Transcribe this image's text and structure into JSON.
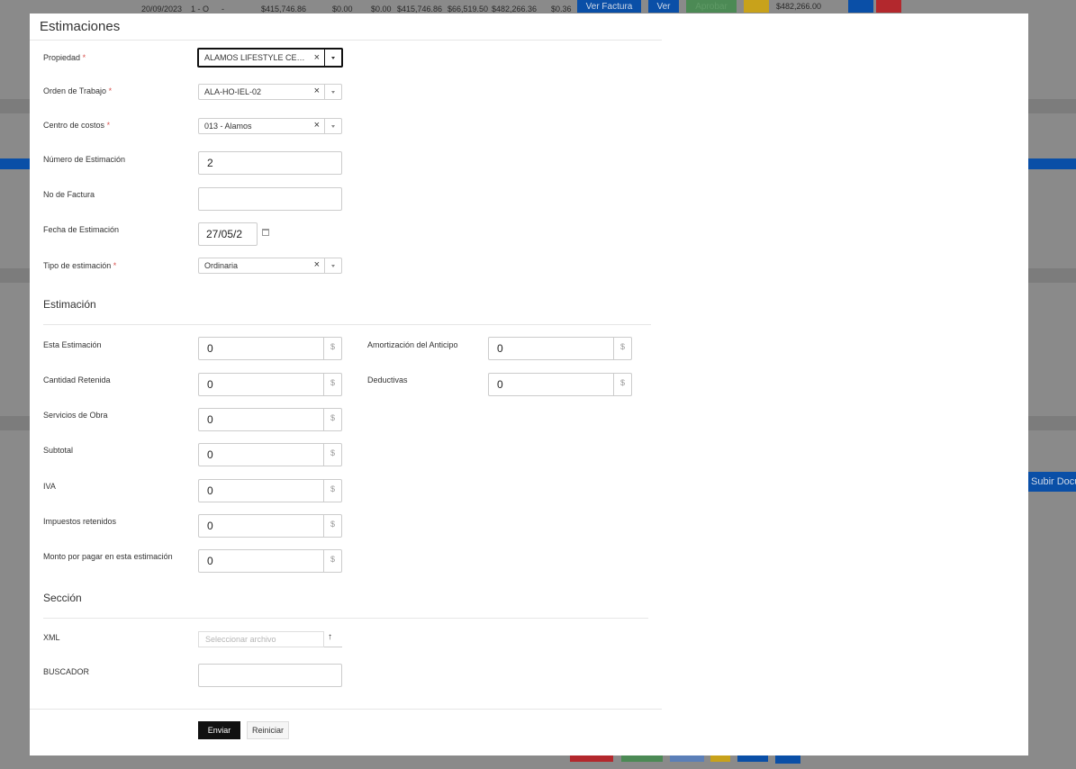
{
  "background": {
    "row": {
      "date": "20/09/2023",
      "folio": "1 - O",
      "dash": "-",
      "amount1": "$415,746.86",
      "amount2": "$0.00",
      "amount3": "$0.00",
      "amount4": "$415,746.86",
      "amount5": "$66,519.50",
      "amount6": "$482,266.36",
      "amount7": "$0.36",
      "ver_factura": "Ver Factura",
      "ver": "Ver",
      "aprobar": "Aprobar",
      "total": "$482,266.00"
    },
    "subir_docs_label": "Subir Docu",
    "colors": {
      "overlay": "#8a8a8a",
      "blue": "#0a4fa7",
      "green": "#4c8a55",
      "red": "#b3282d",
      "yellow": "#c8a21b"
    }
  },
  "modal": {
    "title": "Estimaciones",
    "fields": {
      "propiedad": {
        "label": "Propiedad",
        "required": "*",
        "value": "ALAMOS LIFESTYLE CENTER"
      },
      "orden_trabajo": {
        "label": "Orden de Trabajo",
        "required": "*",
        "value": "ALA-HO-IEL-02"
      },
      "centro_costos": {
        "label": "Centro de costos",
        "required": "*",
        "value": "013 - Alamos"
      },
      "numero_estimacion": {
        "label": "Número de Estimación",
        "value": "2"
      },
      "no_factura": {
        "label": "No de Factura",
        "value": ""
      },
      "fecha_estimacion": {
        "label": "Fecha de Estimación",
        "value": "27/05/2"
      },
      "tipo_estimacion": {
        "label": "Tipo de estimación",
        "required": "*",
        "value": "Ordinaria"
      }
    },
    "clear_glyph": "×",
    "currency_symbol": "$",
    "estimacion": {
      "heading": "Estimación",
      "esta_estimacion": {
        "label": "Esta Estimación",
        "value": "0"
      },
      "amortizacion_anticipo": {
        "label": "Amortización del Anticipo",
        "value": "0"
      },
      "cantidad_retenida": {
        "label": "Cantidad Retenida",
        "value": "0"
      },
      "deductivas": {
        "label": "Deductivas",
        "value": "0"
      },
      "servicios_obra": {
        "label": "Servicios de Obra",
        "value": "0"
      },
      "subtotal": {
        "label": "Subtotal",
        "value": "0"
      },
      "iva": {
        "label": "IVA",
        "value": "0"
      },
      "impuestos_retenidos": {
        "label": "Impuestos retenidos",
        "value": "0"
      },
      "monto_por_pagar": {
        "label": "Monto por pagar en esta estimación",
        "value": "0"
      }
    },
    "seccion": {
      "heading": "Sección",
      "xml": {
        "label": "XML",
        "placeholder": "Seleccionar archivo",
        "upload_glyph": "↑"
      },
      "buscador": {
        "label": "BUSCADOR",
        "value": ""
      }
    },
    "actions": {
      "send_label": "Enviar",
      "reset_label": "Reiniciar"
    }
  }
}
